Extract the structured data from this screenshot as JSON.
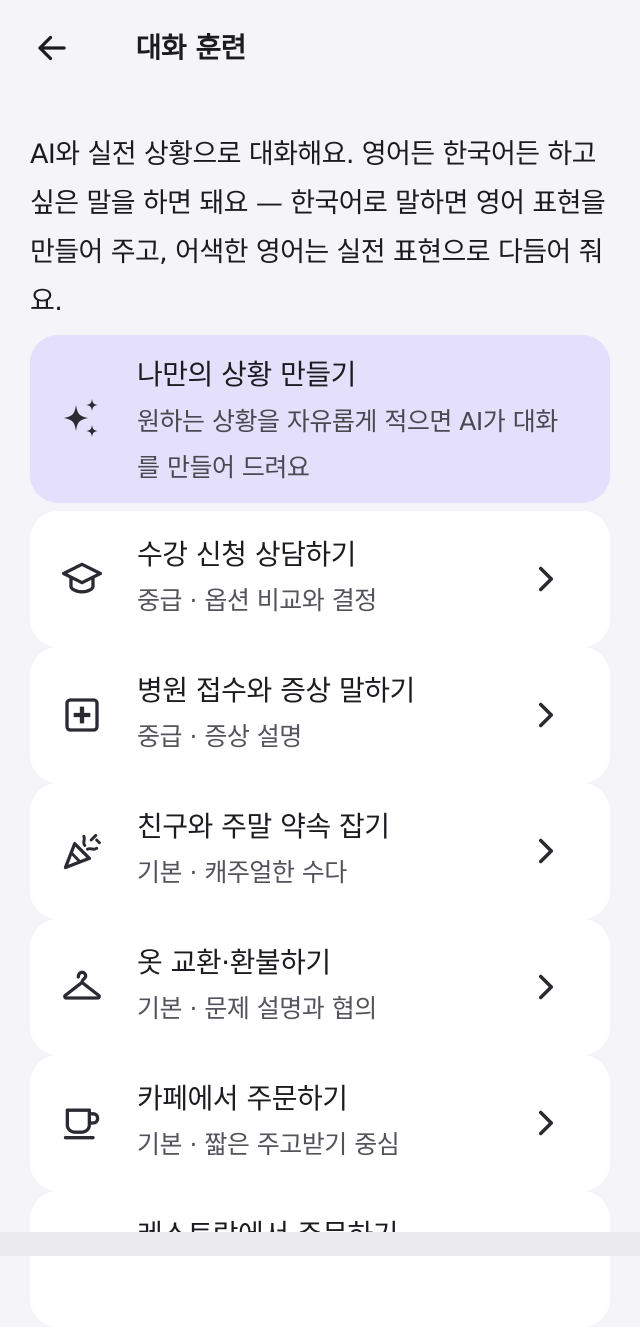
{
  "header": {
    "title": "대화 훈련",
    "back_icon": "arrow-left-icon"
  },
  "intro": {
    "text": "AI와 실전 상황으로 대화해요. 영어든 한국어든 하고 싶은 말을 하면 돼요 — 한국어로 말하면 영어 표현을 만들어 주고, 어색한 영어는 실전 표현으로 다듬어 줘요."
  },
  "custom": {
    "title": "나만의 상황 만들기",
    "description": "원하는 상황을 자유롭게 적으면 AI가 대화를 만들어 드려요",
    "icon": "sparkle-icon",
    "background": "#e4e0fb"
  },
  "scenarios": [
    {
      "title": "수강 신청 상담하기",
      "subtitle": "중급 · 옵션 비교와 결정",
      "icon": "graduation-cap-icon"
    },
    {
      "title": "병원 접수와 증상 말하기",
      "subtitle": "중급 · 증상 설명",
      "icon": "medical-plus-icon"
    },
    {
      "title": "친구와 주말 약속 잡기",
      "subtitle": "기본 · 캐주얼한 수다",
      "icon": "party-popper-icon"
    },
    {
      "title": "옷 교환·환불하기",
      "subtitle": "기본 · 문제 설명과 협의",
      "icon": "hanger-icon"
    },
    {
      "title": "카페에서 주문하기",
      "subtitle": "기본 · 짧은 주고받기 중심",
      "icon": "coffee-cup-icon"
    },
    {
      "title": "레스토랑에서 주문하기",
      "subtitle": "",
      "icon": "restaurant-icon"
    }
  ],
  "colors": {
    "background": "#f5f4f9",
    "card": "#ffffff",
    "text_primary": "#1c1b1f",
    "text_secondary": "#55525c"
  }
}
